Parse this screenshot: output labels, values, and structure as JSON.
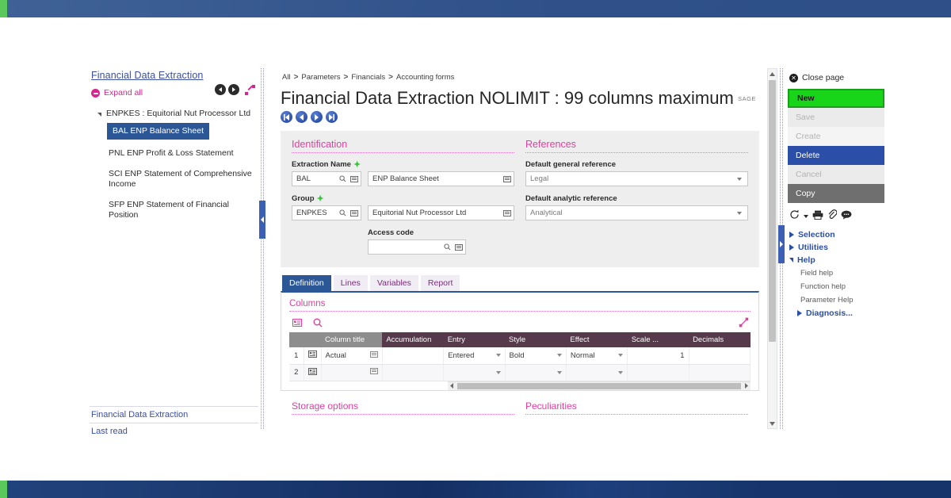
{
  "left_panel": {
    "title": "Financial Data Extraction",
    "expand_all": "Expand all",
    "tree_root": "ENPKES : Equitorial Nut Processor Ltd",
    "tree_children": [
      "BAL ENP Balance Sheet",
      "PNL ENP Profit & Loss Statement",
      "SCI ENP Statement of Comprehensive Income",
      "SFP ENP Statement of Financial Position"
    ],
    "footer": [
      "Financial Data Extraction",
      "Last read"
    ]
  },
  "breadcrumb": [
    "All",
    "Parameters",
    "Financials",
    "Accounting forms"
  ],
  "header": {
    "title": "Financial Data Extraction NOLIMIT : 99 columns maximum",
    "logo": "SAGE"
  },
  "identification": {
    "section_title": "Identification",
    "extraction_name_label": "Extraction Name",
    "extraction_code": "BAL",
    "extraction_desc": "ENP Balance Sheet",
    "group_label": "Group",
    "group_code": "ENPKES",
    "group_desc": "Equitorial Nut Processor Ltd",
    "access_code_label": "Access code",
    "access_code_value": ""
  },
  "references": {
    "section_title": "References",
    "general_label": "Default general reference",
    "general_value": "Legal",
    "analytic_label": "Default analytic reference",
    "analytic_value": "Analytical"
  },
  "tabs": [
    {
      "label": "Definition",
      "active": true
    },
    {
      "label": "Lines",
      "active": false
    },
    {
      "label": "Variables",
      "active": false
    },
    {
      "label": "Report",
      "active": false
    }
  ],
  "columns_section": {
    "title": "Columns",
    "headers": [
      "",
      "",
      "Column title",
      "Accumulation",
      "Entry",
      "Style",
      "Effect",
      "Scale ...",
      "Decimals"
    ],
    "rows": [
      {
        "index": "1",
        "column_title": "Actual",
        "accumulation": "",
        "entry": "Entered",
        "style": "Bold",
        "effect": "Normal",
        "scale": "1",
        "decimals": ""
      },
      {
        "index": "2",
        "column_title": "",
        "accumulation": "",
        "entry": "",
        "style": "",
        "effect": "",
        "scale": "",
        "decimals": ""
      }
    ]
  },
  "bottom_sections": {
    "storage": "Storage options",
    "peculiarities": "Peculiarities"
  },
  "right_panel": {
    "close_page": "Close page",
    "buttons": [
      {
        "label": "New",
        "state": "highlighted"
      },
      {
        "label": "Save",
        "state": "disabled"
      },
      {
        "label": "Create",
        "state": "disabled"
      },
      {
        "label": "Delete",
        "state": "primary"
      },
      {
        "label": "Cancel",
        "state": "disabled"
      },
      {
        "label": "Copy",
        "state": "secondary"
      }
    ],
    "groups": [
      {
        "label": "Selection",
        "open": false
      },
      {
        "label": "Utilities",
        "open": false
      },
      {
        "label": "Help",
        "open": true
      }
    ],
    "help_items": [
      "Field help",
      "Function help",
      "Parameter Help"
    ],
    "diagnosis": "Diagnosis..."
  },
  "colors": {
    "accent_pink": "#e040a0",
    "primary_blue": "#2b5797",
    "new_green": "#19d519",
    "table_header_dark": "#56394a",
    "table_header_gray": "#8d8d8d"
  }
}
